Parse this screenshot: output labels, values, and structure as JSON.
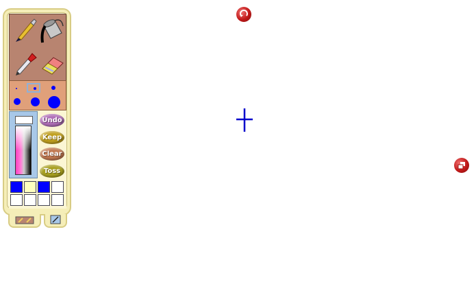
{
  "buttons": {
    "undo": "Undo",
    "keep": "Keep",
    "clear": "Clear",
    "toss": "Toss"
  },
  "tools": [
    "paintbrush-icon",
    "paint-bucket-icon",
    "dropper-icon",
    "eraser-icon"
  ],
  "colors": {
    "undo": "#b070b8",
    "keep": "#c0a020",
    "clear": "#c07850",
    "toss": "#a8a020",
    "ink": "#0000ff"
  },
  "swatches": [
    "#0000ff",
    "#ffffc0",
    "#0000ff",
    "#ffffff",
    "#ffffff",
    "#ffffff",
    "#ffffff",
    "#ffffff"
  ],
  "canvas": {
    "cursor": "crosshair-cursor"
  }
}
